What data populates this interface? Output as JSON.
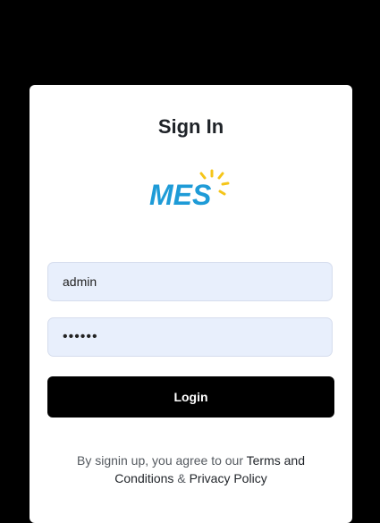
{
  "signin": {
    "title": "Sign In",
    "logo_text": "MES",
    "username_value": "admin",
    "password_value": "••••••",
    "login_label": "Login",
    "terms_prefix": "By signin up, you agree to our",
    "terms_link": "Terms and Conditions",
    "terms_amp": "&",
    "privacy_link": "Privacy Policy"
  },
  "colors": {
    "background": "#000000",
    "card": "#ffffff",
    "input_bg": "#e8effc",
    "button": "#000000",
    "logo_blue": "#1e9bd7",
    "logo_sun": "#f5c518"
  }
}
